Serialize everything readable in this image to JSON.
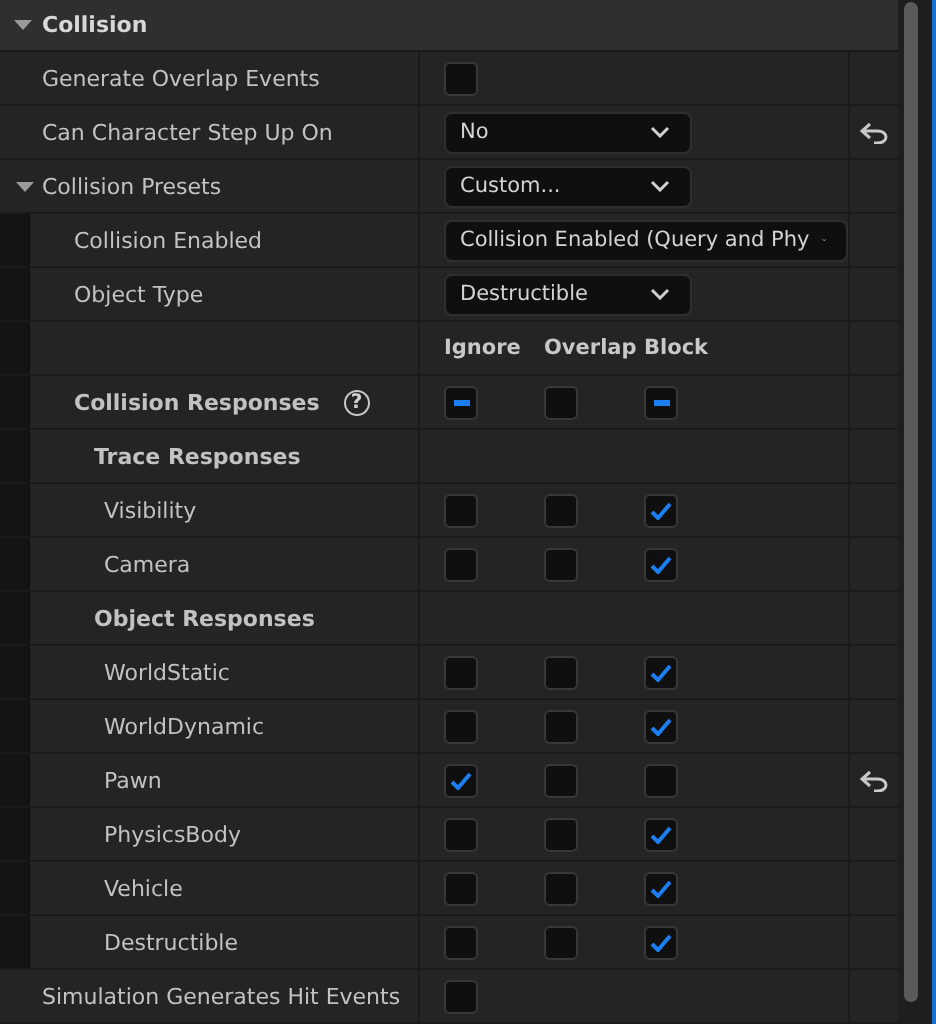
{
  "section": {
    "title": "Collision",
    "expanded": true
  },
  "rows": [
    {
      "kind": "checkbox",
      "label": "Generate Overlap Events",
      "checked": false,
      "resettable": false
    },
    {
      "kind": "dropdown",
      "label": "Can Character Step Up On",
      "value": "No",
      "resettable": true
    },
    {
      "kind": "dropdown",
      "label": "Collision Presets",
      "value": "Custom...",
      "expanded": true,
      "resettable": false,
      "children": [
        {
          "kind": "dropdown",
          "label": "Collision Enabled",
          "value": "Collision Enabled (Query and Phy",
          "resettable": false
        },
        {
          "kind": "dropdown",
          "label": "Object Type",
          "value": "Destructible",
          "resettable": false
        },
        {
          "kind": "columns",
          "labels": [
            "Ignore",
            "Overlap",
            "Block"
          ]
        },
        {
          "kind": "responses",
          "label": "Collision Responses",
          "help": "?",
          "mixed": [
            true,
            false,
            true
          ],
          "resettable": false,
          "children": [
            {
              "kind": "category",
              "label": "Trace Responses",
              "children": [
                {
                  "kind": "responses",
                  "label": "Visibility",
                  "checks": [
                    false,
                    false,
                    true
                  ],
                  "resettable": false
                },
                {
                  "kind": "responses",
                  "label": "Camera",
                  "checks": [
                    false,
                    false,
                    true
                  ],
                  "resettable": false
                }
              ]
            },
            {
              "kind": "category",
              "label": "Object Responses",
              "children": [
                {
                  "kind": "responses",
                  "label": "WorldStatic",
                  "checks": [
                    false,
                    false,
                    true
                  ],
                  "resettable": false
                },
                {
                  "kind": "responses",
                  "label": "WorldDynamic",
                  "checks": [
                    false,
                    false,
                    true
                  ],
                  "resettable": false
                },
                {
                  "kind": "responses",
                  "label": "Pawn",
                  "checks": [
                    true,
                    false,
                    false
                  ],
                  "resettable": true
                },
                {
                  "kind": "responses",
                  "label": "PhysicsBody",
                  "checks": [
                    false,
                    false,
                    true
                  ],
                  "resettable": false
                },
                {
                  "kind": "responses",
                  "label": "Vehicle",
                  "checks": [
                    false,
                    false,
                    true
                  ],
                  "resettable": false
                },
                {
                  "kind": "responses",
                  "label": "Destructible",
                  "checks": [
                    false,
                    false,
                    true
                  ],
                  "resettable": false
                }
              ]
            }
          ]
        }
      ]
    },
    {
      "kind": "checkbox",
      "label": "Simulation Generates Hit Events",
      "checked": false,
      "resettable": false
    }
  ]
}
